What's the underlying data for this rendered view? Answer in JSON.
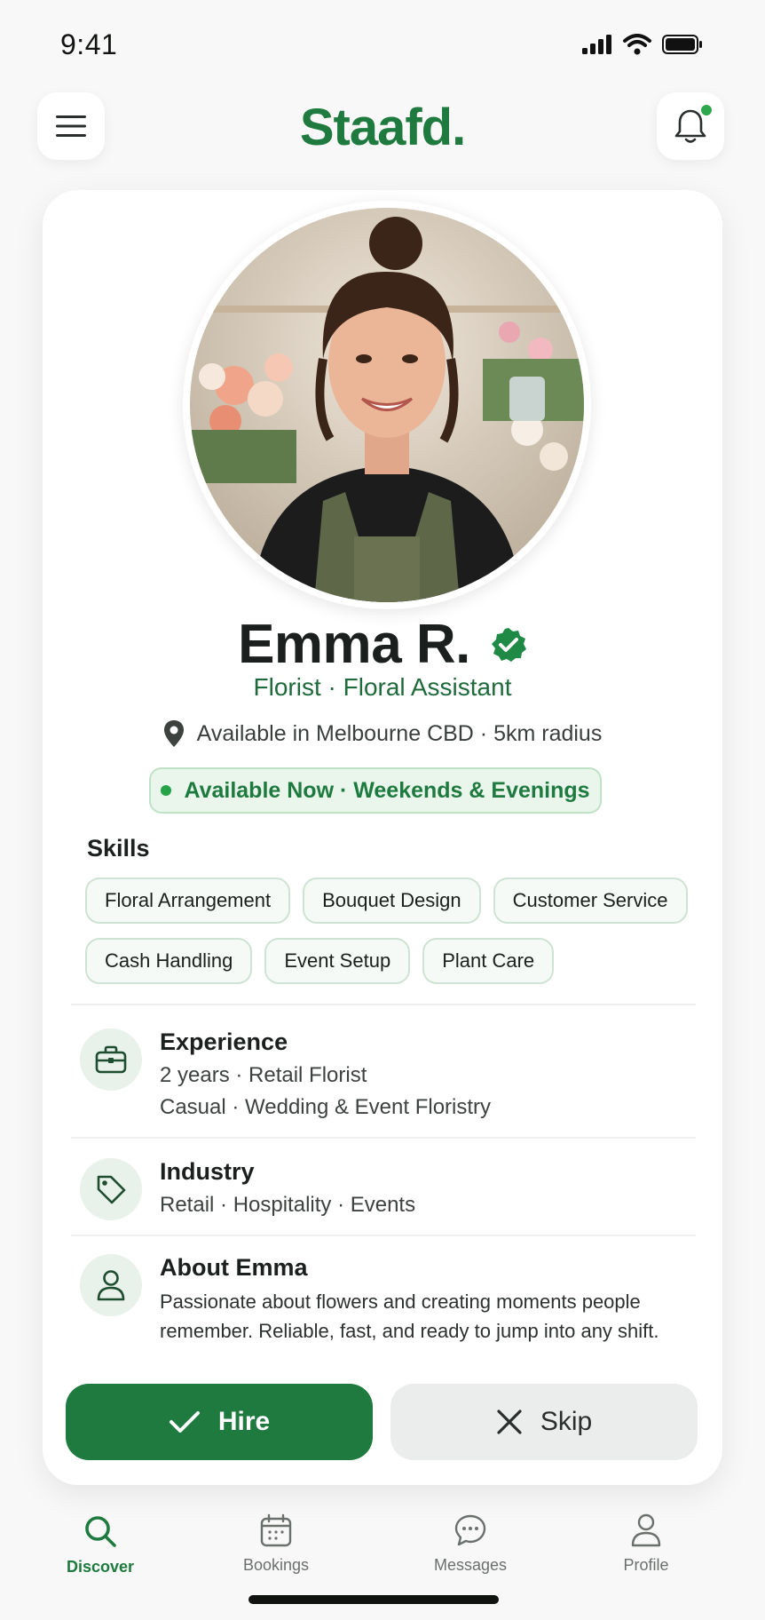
{
  "status_bar": {
    "time": "9:41"
  },
  "header": {
    "brand": "Staafd.",
    "menu_icon": "hamburger-menu-icon",
    "notification_icon": "bell-icon",
    "has_unread": true
  },
  "profile": {
    "name": "Emma R.",
    "verified": true,
    "role": "Florist · Floral Assistant",
    "location": "Available in Melbourne CBD · 5km radius",
    "availability": "Available Now · Weekends & Evenings"
  },
  "skills": {
    "title": "Skills",
    "items": [
      "Floral Arrangement",
      "Bouquet Design",
      "Customer Service",
      "Cash Handling",
      "Event Setup",
      "Plant Care"
    ]
  },
  "experience": {
    "title": "Experience",
    "line1": "2 years · Retail Florist",
    "line2": "Casual · Wedding & Event Floristry",
    "icon": "briefcase-icon"
  },
  "industry": {
    "title": "Industry",
    "line1": "Retail · Hospitality · Events",
    "icon": "tag-icon"
  },
  "about": {
    "title": "About Emma",
    "text": "Passionate about flowers and creating moments people remember. Reliable, fast, and ready to jump into any shift.",
    "icon": "person-icon"
  },
  "actions": {
    "hire": "Hire",
    "skip": "Skip"
  },
  "nav": {
    "items": [
      {
        "label": "Discover",
        "icon": "search-icon",
        "active": true
      },
      {
        "label": "Bookings",
        "icon": "calendar-icon",
        "active": false
      },
      {
        "label": "Messages",
        "icon": "chat-icon",
        "active": false
      },
      {
        "label": "Profile",
        "icon": "person-icon",
        "active": false
      }
    ]
  },
  "colors": {
    "brand_green": "#1e7a3e",
    "accent_dot": "#2ea84f",
    "chip_border": "#cfe3d4",
    "card_bg": "#ffffff",
    "page_bg": "#f7f8f7"
  }
}
